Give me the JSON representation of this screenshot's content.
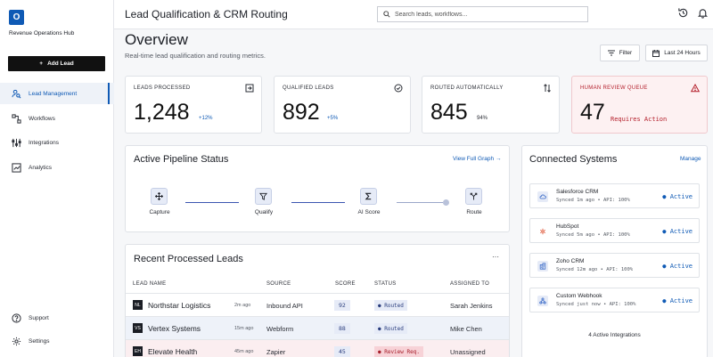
{
  "sidebar": {
    "logo_letter": "O",
    "brand": "Revenue Operations Hub",
    "add_lead": "Add Lead",
    "items": [
      {
        "label": "Lead Management",
        "icon": "user-search-icon"
      },
      {
        "label": "Workflows",
        "icon": "workflow-icon"
      },
      {
        "label": "Integrations",
        "icon": "sliders-icon"
      },
      {
        "label": "Analytics",
        "icon": "chart-icon"
      }
    ],
    "support": "Support",
    "settings": "Settings"
  },
  "header": {
    "title": "Lead Qualification & CRM Routing",
    "search_placeholder": "Search leads, workflows..."
  },
  "overview": {
    "title": "Overview",
    "subtitle": "Real-time lead qualification and routing metrics.",
    "filter": "Filter",
    "range": "Last 24 Hours"
  },
  "metrics": [
    {
      "label": "LEADS PROCESSED",
      "value": "1,248",
      "delta": "+12%",
      "icon": "import-icon"
    },
    {
      "label": "QUALIFIED LEADS",
      "value": "892",
      "delta": "+5%",
      "icon": "check-circle-icon"
    },
    {
      "label": "ROUTED AUTOMATICALLY",
      "value": "845",
      "delta": "94%",
      "icon": "swap-icon"
    },
    {
      "label": "HUMAN REVIEW QUEUE",
      "value": "47",
      "delta": "Requires Action",
      "icon": "warning-icon"
    }
  ],
  "pipeline": {
    "title": "Active Pipeline Status",
    "link": "View Full Graph",
    "stages": [
      "Capture",
      "Qualify",
      "AI Score",
      "Route"
    ]
  },
  "leads": {
    "title": "Recent Processed Leads",
    "more": "···",
    "columns": [
      "LEAD NAME",
      "SOURCE",
      "SCORE",
      "STATUS",
      "ASSIGNED TO"
    ],
    "rows": [
      {
        "initials": "NL",
        "name": "Northstar Logistics",
        "time": "2m ago",
        "source": "Inbound API",
        "score": "92",
        "status": "● Routed",
        "assigned": "Sarah Jenkins"
      },
      {
        "initials": "VS",
        "name": "Vertex Systems",
        "time": "15m ago",
        "source": "Webform",
        "score": "88",
        "status": "● Routed",
        "assigned": "Mike Chen"
      },
      {
        "initials": "EH",
        "name": "Elevate Health",
        "time": "45m ago",
        "source": "Zapier",
        "score": "45",
        "status": "● Review Req.",
        "assigned": "Unassigned"
      }
    ]
  },
  "systems": {
    "title": "Connected Systems",
    "manage": "Manage",
    "items": [
      {
        "name": "Salesforce CRM",
        "sub": "Synced 1m ago • API: 100%",
        "status": "● Active",
        "icon": "cloud-icon"
      },
      {
        "name": "HubSpot",
        "sub": "Synced 5m ago • API: 100%",
        "status": "● Active",
        "icon": "hubspot-icon"
      },
      {
        "name": "Zoho CRM",
        "sub": "Synced 12m ago • API: 100%",
        "status": "● Active",
        "icon": "building-icon"
      },
      {
        "name": "Custom Webhook",
        "sub": "Synced just now • API: 100%",
        "status": "● Active",
        "icon": "webhook-icon"
      }
    ],
    "footer": "4 Active Integrations"
  }
}
